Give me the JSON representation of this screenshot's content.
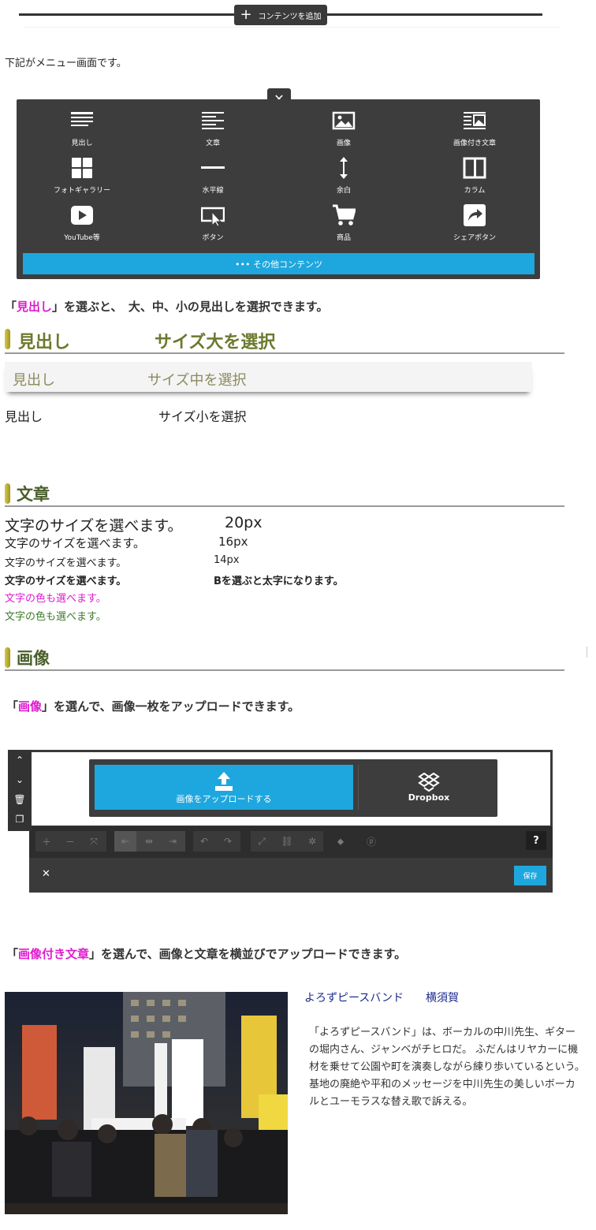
{
  "top_bar": {
    "add_content_label": "コンテンツを追加"
  },
  "intro_text": "下記がメニュー画面です。",
  "menu": {
    "close_label": "✕",
    "items": [
      {
        "label": "見出し",
        "icon": "heading-icon"
      },
      {
        "label": "文章",
        "icon": "text-icon"
      },
      {
        "label": "画像",
        "icon": "image-icon"
      },
      {
        "label": "画像付き文章",
        "icon": "image-text-icon"
      },
      {
        "label": "フォトギャラリー",
        "icon": "gallery-icon"
      },
      {
        "label": "水平線",
        "icon": "hr-icon"
      },
      {
        "label": "余白",
        "icon": "spacing-icon"
      },
      {
        "label": "カラム",
        "icon": "column-icon"
      },
      {
        "label": "YouTube等",
        "icon": "youtube-icon"
      },
      {
        "label": "ボタン",
        "icon": "button-icon"
      },
      {
        "label": "商品",
        "icon": "cart-icon"
      },
      {
        "label": "シェアボタン",
        "icon": "share-icon"
      }
    ],
    "more_label": "••• その他コンテンツ"
  },
  "heading_section": {
    "lead_open": "「",
    "lead_highlight": "見出し",
    "lead_rest": "」を選ぶと、　大、中、小の見出しを選択できます。",
    "large": {
      "name": "見出し",
      "desc": "サイズ大を選択"
    },
    "medium": {
      "name": "見出し",
      "desc": "サイズ中を選択"
    },
    "small": {
      "name": "見出し",
      "desc": "サイズ小を選択"
    }
  },
  "text_section": {
    "title": "文章",
    "line20": {
      "text": "文字のサイズを選べます。",
      "size": "20px"
    },
    "line16": {
      "text": "文字のサイズを選べます。",
      "size": "16px"
    },
    "line14": {
      "text": "文字のサイズを選べます。",
      "size": "14px"
    },
    "line_bold": {
      "text": "文字のサイズを選べます。",
      "note": "Bを選ぶと太字になります。"
    },
    "color_pink": "文字の色も選べます。",
    "color_green": "文字の色も選べます。",
    "colors": {
      "pink": "#e01bd0",
      "green": "#3c7a2a"
    }
  },
  "image_section": {
    "title": "画像",
    "lead_open": "「",
    "lead_highlight": "画像",
    "lead_rest": "」を選んで、画像一枚をアップロードできます。",
    "editor": {
      "upload_label": "画像をアップロードする",
      "dropbox_label": "Dropbox",
      "help_label": "?",
      "close_label": "✕",
      "save_label": "保存"
    }
  },
  "image_text_section": {
    "lead_open": "「",
    "lead_highlight": "画像付き文章",
    "lead_rest": "」を選んで、画像と文章を横並びでアップロードできます。",
    "article_title": "よろずピースバンド　　横須賀",
    "article_body": "「よろずピースバンド」は、ボーカルの中川先生、ギターの堀内さん、ジャンベがチヒロだ。 ふだんはリヤカーに機材を乗せて公園や町を演奏しながら練り歩いているという。 基地の廃絶や平和のメッセージを中川先生の美しいボーカルとユーモラスな替え歌で訴える。"
  },
  "accent_color": "#1ea7de"
}
